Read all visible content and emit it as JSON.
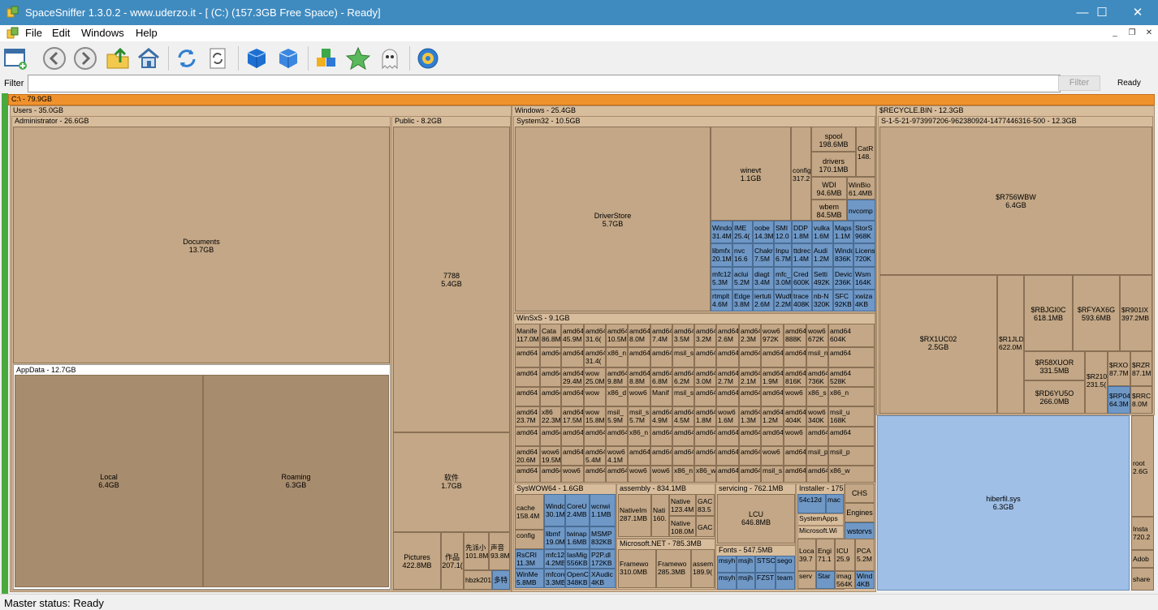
{
  "window": {
    "title": "SpaceSniffer 1.3.0.2 - www.uderzo.it - [ (C:) (157.3GB Free Space) - Ready]",
    "minimize": "—",
    "maximize": "☐",
    "close": "✕"
  },
  "menu": {
    "items": [
      "File",
      "Edit",
      "Windows",
      "Help"
    ],
    "mdi_minimize": "_",
    "mdi_restore": "❐",
    "mdi_close": "✕"
  },
  "toolbar": {
    "icons": [
      "new-window-icon",
      "back-icon",
      "forward-icon",
      "up-folder-icon",
      "home-icon",
      "refresh-icon",
      "refresh-selected-icon",
      "blue-cube-icon",
      "blue-cube-alt-icon",
      "colored-boxes-icon",
      "green-star-icon",
      "ghost-icon",
      "gear-icon"
    ]
  },
  "filter": {
    "label": "Filter",
    "value": "",
    "button": "Filter",
    "status": "Ready"
  },
  "treemap": {
    "root": "C:\\ - 79.9GB",
    "users": "Users - 35.0GB",
    "administrator": "Administrator - 26.6GB",
    "documents": {
      "name": "Documents",
      "size": "13.7GB"
    },
    "appdata": "AppData - 12.7GB",
    "local": {
      "name": "Local",
      "size": "6.4GB"
    },
    "roaming": {
      "name": "Roaming",
      "size": "6.3GB"
    },
    "public": "Public - 8.2GB",
    "p7788": {
      "name": "7788",
      "size": "5.4GB"
    },
    "zuojian": {
      "name": "软件",
      "size": "1.7GB"
    },
    "pictures": {
      "name": "Pictures",
      "size": "422.8MB"
    },
    "zuopin": {
      "name": "作品",
      "size": "207.1("
    },
    "public_small": [
      {
        "name": "先派小",
        "size": "101.8M"
      },
      {
        "name": "声音",
        "size": "93.8M"
      },
      {
        "name": "hbzk201",
        "size": ""
      },
      {
        "name": "多特",
        "size": ""
      }
    ],
    "windows": "Windows - 25.4GB",
    "system32": "System32 - 10.5GB",
    "driverstore": {
      "name": "DriverStore",
      "size": "5.7GB"
    },
    "winevt": {
      "name": "winevt",
      "size": "1.1GB"
    },
    "config": {
      "name": "config",
      "size": "317.2"
    },
    "spool": {
      "name": "spool",
      "size": "198.6MB"
    },
    "catroot": {
      "name": "CatR",
      "size": "148."
    },
    "drivers": {
      "name": "drivers",
      "size": "170.1MB"
    },
    "wdi": {
      "name": "WDI",
      "size": "94.6MB"
    },
    "winbio": {
      "name": "WinBio",
      "size": "61.4MB"
    },
    "wbem": {
      "name": "wbem",
      "size": "84.5MB"
    },
    "nvcomp": {
      "name": "nvcomp",
      "size": ""
    },
    "sys32_small": [
      {
        "name": "Windo",
        "size": "31.4M"
      },
      {
        "name": "IME",
        "size": "25.4("
      },
      {
        "name": "oobe",
        "size": "14.3M"
      },
      {
        "name": "SMI",
        "size": "12.0"
      },
      {
        "name": "DDP",
        "size": "1.8M"
      },
      {
        "name": "vulka",
        "size": "1.6M"
      },
      {
        "name": "Maps",
        "size": "1.1M"
      },
      {
        "name": "StorS",
        "size": "968K"
      },
      {
        "name": "libmfx",
        "size": "20.1M"
      },
      {
        "name": "nvc",
        "size": "16.6"
      },
      {
        "name": "Chakr",
        "size": "7.5M"
      },
      {
        "name": "Inpu",
        "size": "6.7M"
      },
      {
        "name": "ttdrec",
        "size": "1.4M"
      },
      {
        "name": "Audi",
        "size": "1.2M"
      },
      {
        "name": "Windo",
        "size": "836K"
      },
      {
        "name": "Licens",
        "size": "720K"
      },
      {
        "name": "mfc12",
        "size": "5.3M"
      },
      {
        "name": "aclui",
        "size": "5.2M"
      },
      {
        "name": "diagt",
        "size": "3.4M"
      },
      {
        "name": "mfc_",
        "size": "3.0M"
      },
      {
        "name": "Cred",
        "size": "600K"
      },
      {
        "name": "Setti",
        "size": "492K"
      },
      {
        "name": "Devic",
        "size": "236K"
      },
      {
        "name": "Wsm",
        "size": "164K"
      },
      {
        "name": "rtmplt",
        "size": "4.6M"
      },
      {
        "name": "Edge",
        "size": "3.8M"
      },
      {
        "name": "iertuti",
        "size": "2.6M"
      },
      {
        "name": "Wudf",
        "size": "2.2M"
      },
      {
        "name": "trace",
        "size": "408K"
      },
      {
        "name": "nb-N",
        "size": "320K"
      },
      {
        "name": "SFC",
        "size": "92KB"
      },
      {
        "name": "xwiza",
        "size": "4KB"
      }
    ],
    "winsxs": "WinSxS - 9.1GB",
    "winsxs_cells": [
      {
        "name": "Manife",
        "size": "117.0M"
      },
      {
        "name": "Cata",
        "size": "86.8M"
      },
      {
        "name": "amd64",
        "size": "45.9M"
      },
      {
        "name": "amd64",
        "size": "31.6("
      },
      {
        "name": "amd64",
        "size": "10.5M"
      },
      {
        "name": "amd64",
        "size": "8.0M"
      },
      {
        "name": "amd64",
        "size": "7.4M"
      },
      {
        "name": "amd64",
        "size": "3.5M"
      },
      {
        "name": "amd64",
        "size": "3.2M"
      },
      {
        "name": "amd64",
        "size": "2.6M"
      },
      {
        "name": "amd64",
        "size": "2.3M"
      },
      {
        "name": "wow6",
        "size": "972K"
      },
      {
        "name": "amd64",
        "size": "888K"
      },
      {
        "name": "wow6",
        "size": "672K"
      },
      {
        "name": "amd64",
        "size": "604K"
      },
      {
        "name": "amd64",
        "size": ""
      },
      {
        "name": "amd64",
        "size": ""
      },
      {
        "name": "amd64",
        "size": ""
      },
      {
        "name": "amd64",
        "size": "31.4("
      },
      {
        "name": "x86_n",
        "size": ""
      },
      {
        "name": "amd64",
        "size": ""
      },
      {
        "name": "amd64",
        "size": ""
      },
      {
        "name": "msil_s",
        "size": ""
      },
      {
        "name": "amd64",
        "size": ""
      },
      {
        "name": "amd64",
        "size": ""
      },
      {
        "name": "amd64",
        "size": ""
      },
      {
        "name": "amd64",
        "size": ""
      },
      {
        "name": "amd64",
        "size": ""
      },
      {
        "name": "msil_n",
        "size": ""
      },
      {
        "name": "amd64",
        "size": ""
      },
      {
        "name": "amd64",
        "size": ""
      },
      {
        "name": "amd64",
        "size": ""
      },
      {
        "name": "amd64",
        "size": "29.4M"
      },
      {
        "name": "wow",
        "size": "25.0M"
      },
      {
        "name": "amd64",
        "size": "9.8M"
      },
      {
        "name": "amd64",
        "size": "8.8M"
      },
      {
        "name": "amd64",
        "size": "6.8M"
      },
      {
        "name": "amd64",
        "size": "6.2M"
      },
      {
        "name": "amd64",
        "size": "3.0M"
      },
      {
        "name": "amd64",
        "size": "2.7M"
      },
      {
        "name": "amd64",
        "size": "2.1M"
      },
      {
        "name": "amd64",
        "size": "1.9M"
      },
      {
        "name": "amd64",
        "size": "816K"
      },
      {
        "name": "amd64",
        "size": "736K"
      },
      {
        "name": "amd64",
        "size": "528K"
      },
      {
        "name": "amd64",
        "size": ""
      },
      {
        "name": "amd64",
        "size": ""
      },
      {
        "name": "amd64",
        "size": ""
      },
      {
        "name": "wow",
        "size": ""
      },
      {
        "name": "x86_d",
        "size": ""
      },
      {
        "name": "wow6",
        "size": ""
      },
      {
        "name": "Manif",
        "size": ""
      },
      {
        "name": "msil_s",
        "size": ""
      },
      {
        "name": "amd64",
        "size": ""
      },
      {
        "name": "amd64",
        "size": ""
      },
      {
        "name": "amd64",
        "size": ""
      },
      {
        "name": "amd64",
        "size": ""
      },
      {
        "name": "wow6",
        "size": ""
      },
      {
        "name": "x86_s",
        "size": ""
      },
      {
        "name": "x86_n",
        "size": ""
      },
      {
        "name": "amd64",
        "size": "23.7M"
      },
      {
        "name": "x86",
        "size": "22.3M"
      },
      {
        "name": "amd64",
        "size": "17.5M"
      },
      {
        "name": "wow",
        "size": "15.8M"
      },
      {
        "name": "msil_",
        "size": "5.9M"
      },
      {
        "name": "msil_s",
        "size": "5.7M"
      },
      {
        "name": "amd64",
        "size": "4.9M"
      },
      {
        "name": "amd64",
        "size": "4.5M"
      },
      {
        "name": "amd64",
        "size": "1.8M"
      },
      {
        "name": "wow6",
        "size": "1.6M"
      },
      {
        "name": "amd64",
        "size": "1.3M"
      },
      {
        "name": "amd64",
        "size": "1.2M"
      },
      {
        "name": "amd64",
        "size": "404K"
      },
      {
        "name": "wow6",
        "size": "340K"
      },
      {
        "name": "msil_u",
        "size": "168K"
      },
      {
        "name": "amd64",
        "size": ""
      },
      {
        "name": "amd64",
        "size": ""
      },
      {
        "name": "amd64",
        "size": ""
      },
      {
        "name": "amd64",
        "size": ""
      },
      {
        "name": "amd64",
        "size": ""
      },
      {
        "name": "x86_n",
        "size": ""
      },
      {
        "name": "amd64",
        "size": ""
      },
      {
        "name": "amd64",
        "size": ""
      },
      {
        "name": "amd64",
        "size": ""
      },
      {
        "name": "amd64",
        "size": ""
      },
      {
        "name": "amd64",
        "size": ""
      },
      {
        "name": "amd64",
        "size": ""
      },
      {
        "name": "wow6",
        "size": ""
      },
      {
        "name": "amd64",
        "size": ""
      },
      {
        "name": "amd64",
        "size": ""
      },
      {
        "name": "amd64",
        "size": "20.6M"
      },
      {
        "name": "wow6",
        "size": "19.5M"
      },
      {
        "name": "amd64",
        "size": ""
      },
      {
        "name": "amd64",
        "size": "5.4M"
      },
      {
        "name": "wow6",
        "size": "4.1M"
      },
      {
        "name": "amd64",
        "size": ""
      },
      {
        "name": "amd64",
        "size": ""
      },
      {
        "name": "amd64",
        "size": ""
      },
      {
        "name": "amd64",
        "size": ""
      },
      {
        "name": "amd64",
        "size": ""
      },
      {
        "name": "amd64",
        "size": ""
      },
      {
        "name": "wow6",
        "size": ""
      },
      {
        "name": "amd64",
        "size": ""
      },
      {
        "name": "msil_p",
        "size": ""
      },
      {
        "name": "msil_p",
        "size": ""
      },
      {
        "name": "amd64",
        "size": ""
      },
      {
        "name": "amd64",
        "size": ""
      },
      {
        "name": "wow6",
        "size": ""
      },
      {
        "name": "amd64",
        "size": ""
      },
      {
        "name": "amd64",
        "size": ""
      },
      {
        "name": "wow6",
        "size": ""
      },
      {
        "name": "wow6",
        "size": ""
      },
      {
        "name": "x86_n",
        "size": ""
      },
      {
        "name": "x86_w",
        "size": ""
      },
      {
        "name": "amd64",
        "size": ""
      },
      {
        "name": "amd64",
        "size": ""
      },
      {
        "name": "msil_s",
        "size": ""
      },
      {
        "name": "amd64",
        "size": ""
      },
      {
        "name": "amd64",
        "size": ""
      },
      {
        "name": "x86_w",
        "size": ""
      }
    ],
    "syswow64": "SysWOW64 - 1.6GB",
    "syswow_cells": [
      {
        "name": "cache",
        "size": "158.4M"
      },
      {
        "name": "config",
        "size": ""
      },
      {
        "name": "RsCRI",
        "size": "11.3M"
      },
      {
        "name": "WinMe",
        "size": "5.8MB"
      },
      {
        "name": "Windo",
        "size": "30.1M"
      },
      {
        "name": "CoreU",
        "size": "2.4MB"
      },
      {
        "name": "wcnwi",
        "size": "1.1MB"
      },
      {
        "name": "libmf",
        "size": "19.0M"
      },
      {
        "name": "twinap",
        "size": "1.6MB"
      },
      {
        "name": "MSMP",
        "size": "832KB"
      },
      {
        "name": "mfc120",
        "size": "4.2MB"
      },
      {
        "name": "IasMig",
        "size": "556KB"
      },
      {
        "name": "P2P.dl",
        "size": "172KB"
      },
      {
        "name": "mfcore",
        "size": "3.3MB"
      },
      {
        "name": "OpenC",
        "size": "348KB"
      },
      {
        "name": "XAudic",
        "size": "4KB"
      }
    ],
    "assembly": "assembly - 834.1MB",
    "nativeimages": {
      "name": "NativeIm",
      "size": "287.1MB"
    },
    "nati": {
      "name": "Nati",
      "size": "160."
    },
    "native1": {
      "name": "Native",
      "size": "123.4M"
    },
    "native2": {
      "name": "Native",
      "size": "108.0M"
    },
    "gac1": {
      "name": "GAC",
      "size": "83.5"
    },
    "gac2": {
      "name": "GAC",
      "size": ""
    },
    "dotnet": "Microsoft.NET - 785.3MB",
    "framework": {
      "name": "Framewo",
      "size": "310.0MB"
    },
    "framework64": {
      "name": "Framewo",
      "size": "285.3MB"
    },
    "assem": {
      "name": "assem",
      "size": "189.9("
    },
    "servicing": "servicing - 762.1MB",
    "lcu": {
      "name": "LCU",
      "size": "646.8MB"
    },
    "fonts": "Fonts - 547.5MB",
    "font_cells": [
      "msyh",
      "msjh",
      "STSC",
      "sego",
      "msyh",
      "msjh",
      "FZST",
      "team"
    ],
    "installer": "Installer - 175",
    "installer_cells": [
      {
        "name": "54c12d",
        "size": ""
      },
      {
        "name": "mac",
        "size": ""
      },
      {
        "name": "SystemApps",
        "size": ""
      },
      {
        "name": "Microsoft.Wi",
        "size": ""
      },
      {
        "name": "Loca",
        "size": "39.7"
      },
      {
        "name": "Engi",
        "size": "71.1"
      },
      {
        "name": "serv",
        "size": ""
      },
      {
        "name": "Star",
        "size": ""
      },
      {
        "name": "ICU",
        "size": "25.9"
      },
      {
        "name": "PCA",
        "size": "5.2M"
      },
      {
        "name": "imag",
        "size": "564K"
      },
      {
        "name": "Wind",
        "size": "4KB"
      }
    ],
    "chs": {
      "name": "CHS",
      "size": ""
    },
    "engines": {
      "name": "Engines",
      "size": ""
    },
    "wstorvs": {
      "name": "wstorvs",
      "size": ""
    },
    "recycle": "$RECYCLE.BIN - 12.3GB",
    "sid": "S-1-5-21-973997206-962380924-1477446316-500 - 12.3GB",
    "r756": {
      "name": "$R756WBW",
      "size": "6.4GB"
    },
    "rx1u": {
      "name": "$RX1UC02",
      "size": "2.5GB"
    },
    "r1jl": {
      "name": "$R1JLD",
      "size": "622.0M"
    },
    "rbjg": {
      "name": "$RBJGI0C",
      "size": "618.1MB"
    },
    "rfya": {
      "name": "$RFYAX6G",
      "size": "593.6MB"
    },
    "r901": {
      "name": "$R901IX",
      "size": "397.2MB"
    },
    "r58x": {
      "name": "$R58XUOR",
      "size": "331.5MB"
    },
    "r210": {
      "name": "$R210",
      "size": "231.5("
    },
    "rxo": {
      "name": "$RXO",
      "size": "87.7M"
    },
    "rzr": {
      "name": "$RZR",
      "size": "87.1M"
    },
    "rd6y": {
      "name": "$RD6YU5O",
      "size": "266.0MB"
    },
    "rp04": {
      "name": "$RP04",
      "size": "64.3M"
    },
    "rrc": {
      "name": "$RRC",
      "size": "8.0M"
    },
    "hiberfil": {
      "name": "hiberfil.sys",
      "size": "6.3GB"
    },
    "rootdir": {
      "name": "root",
      "size": "2.6G"
    },
    "insta": {
      "name": "Insta",
      "size": "720.2"
    },
    "adob": {
      "name": "Adob",
      "size": ""
    },
    "share": {
      "name": "share",
      "size": ""
    }
  },
  "status": {
    "text": "Master status: Ready"
  },
  "colors": {
    "titlebar": "#3f8bc0",
    "root_bar": "#f0922c",
    "folder_tan": "#c3a786",
    "folder_dark": "#a88c6e",
    "file_blue": "#6f98c6",
    "file_lightblue": "#9fbfe6",
    "left_strip_green": "#48aa3c"
  }
}
